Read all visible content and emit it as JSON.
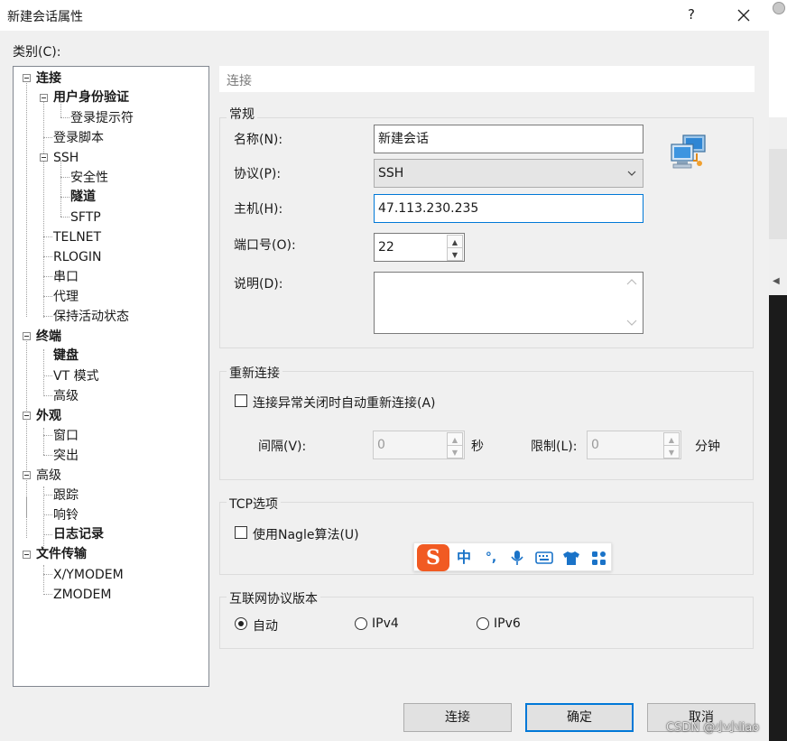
{
  "window": {
    "title": "新建会话属性",
    "help_label": "?"
  },
  "category_label": "类别(C):",
  "tree": [
    {
      "label": "连接",
      "bold": true
    },
    {
      "label": "用户身份验证",
      "bold": true
    },
    {
      "label": "登录提示符",
      "bold": false
    },
    {
      "label": "登录脚本",
      "bold": false
    },
    {
      "label": "SSH",
      "bold": false
    },
    {
      "label": "安全性",
      "bold": false
    },
    {
      "label": "隧道",
      "bold": true
    },
    {
      "label": "SFTP",
      "bold": false
    },
    {
      "label": "TELNET",
      "bold": false
    },
    {
      "label": "RLOGIN",
      "bold": false
    },
    {
      "label": "串口",
      "bold": false
    },
    {
      "label": "代理",
      "bold": false
    },
    {
      "label": "保持活动状态",
      "bold": false
    },
    {
      "label": "终端",
      "bold": true
    },
    {
      "label": "键盘",
      "bold": true
    },
    {
      "label": "VT 模式",
      "bold": false
    },
    {
      "label": "高级",
      "bold": false
    },
    {
      "label": "外观",
      "bold": true
    },
    {
      "label": "窗口",
      "bold": false
    },
    {
      "label": "突出",
      "bold": false
    },
    {
      "label": "高级",
      "bold": false
    },
    {
      "label": "跟踪",
      "bold": false
    },
    {
      "label": "响铃",
      "bold": false
    },
    {
      "label": "日志记录",
      "bold": true
    },
    {
      "label": "文件传输",
      "bold": true
    },
    {
      "label": "X/YMODEM",
      "bold": false
    },
    {
      "label": "ZMODEM",
      "bold": false
    }
  ],
  "section_header": "连接",
  "general": {
    "title": "常规",
    "name_label": "名称(N):",
    "name_value": "新建会话",
    "protocol_label": "协议(P):",
    "protocol_value": "SSH",
    "host_label": "主机(H):",
    "host_value": "47.113.230.235",
    "port_label": "端口号(O):",
    "port_value": "22",
    "desc_label": "说明(D):",
    "desc_value": ""
  },
  "reconnect": {
    "title": "重新连接",
    "checkbox_label": "连接异常关闭时自动重新连接(A)",
    "checked": false,
    "interval_label": "间隔(V):",
    "interval_value": "0",
    "interval_unit": "秒",
    "limit_label": "限制(L):",
    "limit_value": "0",
    "limit_unit": "分钟"
  },
  "tcp": {
    "title": "TCP选项",
    "nagle_label": "使用Nagle算法(U)",
    "checked": false
  },
  "ip_version": {
    "title": "互联网协议版本",
    "options": [
      "自动",
      "IPv4",
      "IPv6"
    ],
    "selected": "自动"
  },
  "ime": {
    "mode_label": "中",
    "punct_label": "°,"
  },
  "buttons": {
    "connect": "连接",
    "ok": "确定",
    "cancel": "取消"
  },
  "watermark": "CSDN @小小liao",
  "colors": {
    "accent": "#0078d7",
    "ime_logo": "#f15a22",
    "ime_icons": "#1a73c8"
  }
}
